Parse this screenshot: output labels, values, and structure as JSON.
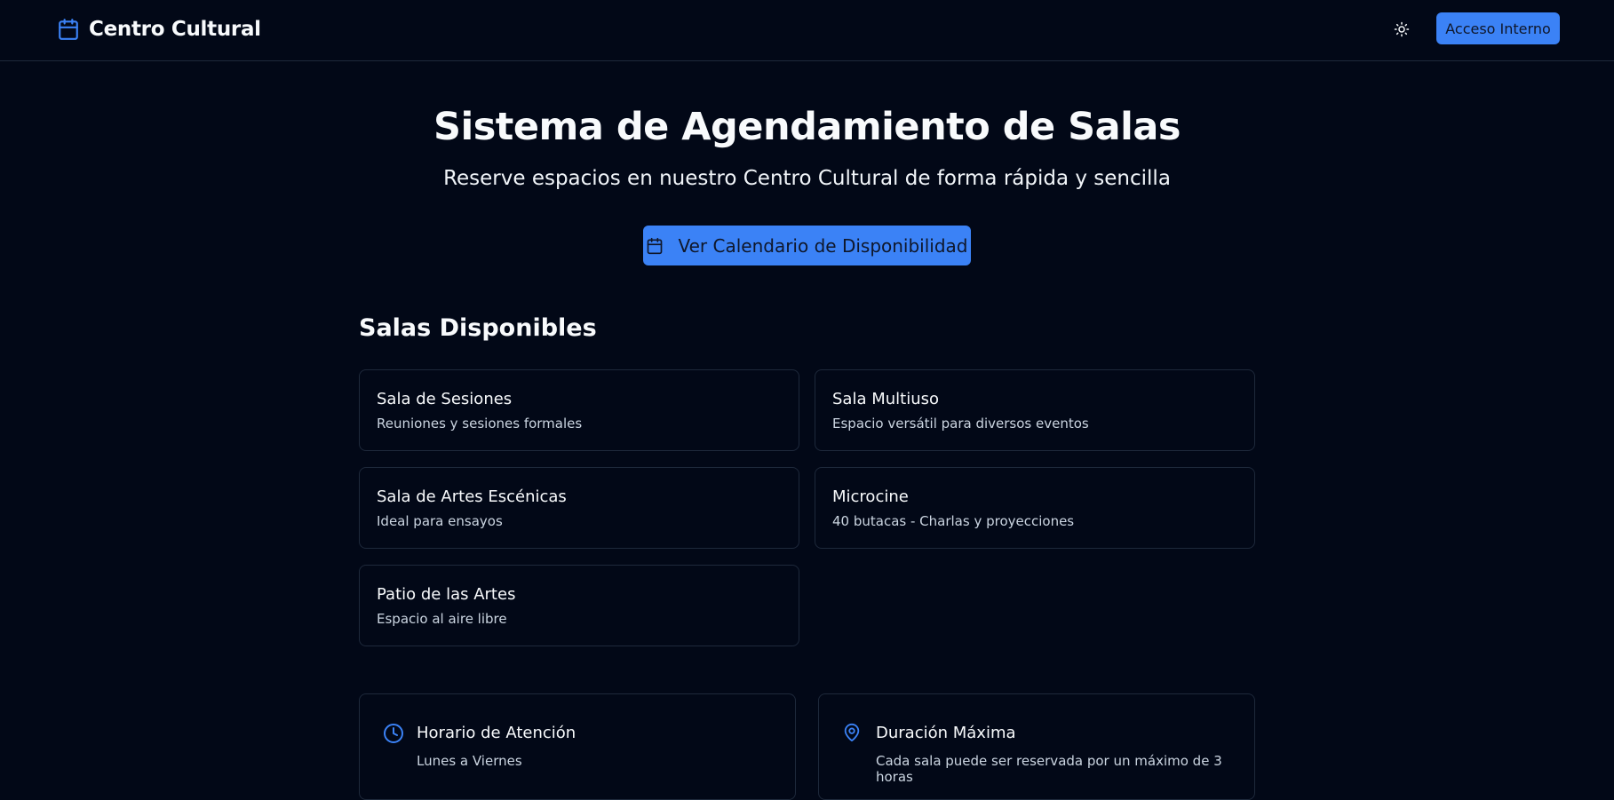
{
  "header": {
    "brand": "Centro Cultural",
    "brand_icon": "calendar-icon",
    "theme_icon": "sun-icon",
    "login_label": "Acceso Interno",
    "accent_color": "#3b82f6"
  },
  "hero": {
    "title": "Sistema de Agendamiento de Salas",
    "subtitle": "Reserve espacios en nuestro Centro Cultural de forma rápida y sencilla",
    "cta_label": "Ver Calendario de Disponibilidad",
    "cta_icon": "calendar-icon"
  },
  "rooms": {
    "title": "Salas Disponibles",
    "items": [
      {
        "name": "Sala de Sesiones",
        "description": "Reuniones y sesiones formales"
      },
      {
        "name": "Sala Multiuso",
        "description": "Espacio versátil para diversos eventos"
      },
      {
        "name": "Sala de Artes Escénicas",
        "description": "Ideal para ensayos"
      },
      {
        "name": "Microcine",
        "description": "40 butacas - Charlas y proyecciones"
      },
      {
        "name": "Patio de las Artes",
        "description": "Espacio al aire libre"
      }
    ]
  },
  "info": [
    {
      "icon": "clock-icon",
      "title": "Horario de Atención",
      "description": "Lunes a Viernes"
    },
    {
      "icon": "map-pin-icon",
      "title": "Duración Máxima",
      "description": "Cada sala puede ser reservada por un máximo de 3 horas"
    }
  ]
}
